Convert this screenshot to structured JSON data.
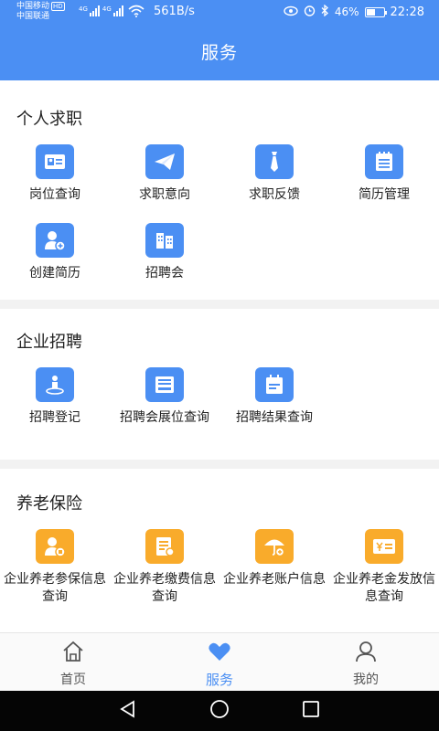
{
  "status": {
    "carrier1": "中国移动",
    "hd": "HD",
    "carrier2": "中国联通",
    "net1": "4G",
    "net2": "4G",
    "speed": "561B/s",
    "battery": "46%",
    "battery_level": 0.46,
    "time": "22:28"
  },
  "header": {
    "title": "服务"
  },
  "sections": [
    {
      "title": "个人求职",
      "items": [
        {
          "label": "岗位查询",
          "icon": "id-card-icon"
        },
        {
          "label": "求职意向",
          "icon": "paper-plane-icon"
        },
        {
          "label": "求职反馈",
          "icon": "tie-icon"
        },
        {
          "label": "简历管理",
          "icon": "notepad-icon"
        },
        {
          "label": "创建简历",
          "icon": "user-add-icon"
        },
        {
          "label": "招聘会",
          "icon": "building-icon"
        }
      ]
    },
    {
      "title": "企业招聘",
      "items": [
        {
          "label": "招聘登记",
          "icon": "person-pin-icon"
        },
        {
          "label": "招聘会展位查询",
          "icon": "booth-icon"
        },
        {
          "label": "招聘结果查询",
          "icon": "calendar-icon"
        }
      ]
    },
    {
      "title": "养老保险",
      "items": [
        {
          "label": "企业养老参保信息查询",
          "icon": "user-badge-icon"
        },
        {
          "label": "企业养老缴费信息查询",
          "icon": "bill-icon"
        },
        {
          "label": "企业养老账户信息",
          "icon": "umbrella-icon"
        },
        {
          "label": "企业养老金发放信息查询",
          "icon": "yuan-card-icon"
        }
      ]
    }
  ],
  "tabs": [
    {
      "label": "首页",
      "icon": "home-icon"
    },
    {
      "label": "服务",
      "icon": "heart-icon"
    },
    {
      "label": "我的",
      "icon": "user-icon"
    }
  ],
  "colors": {
    "brand": "#4b8ff3",
    "orange": "#f9ab2b"
  }
}
